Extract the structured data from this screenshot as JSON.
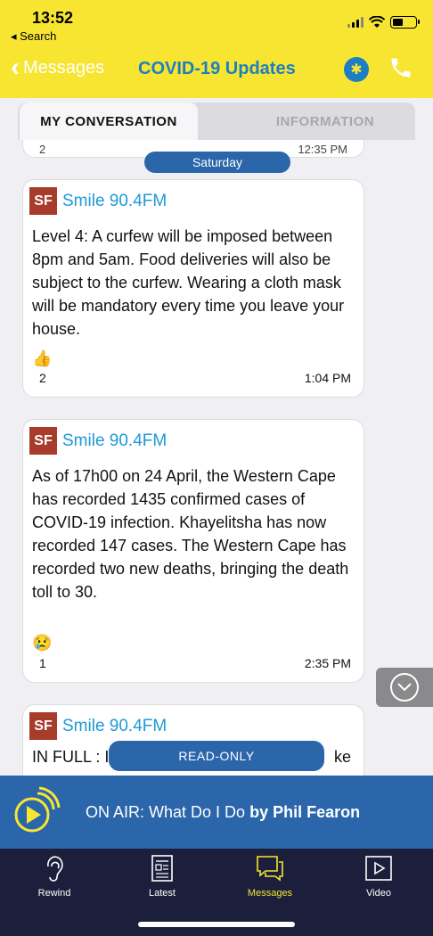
{
  "status_bar": {
    "time": "13:52",
    "back_app": "◂ Search"
  },
  "nav": {
    "back_label": "Messages",
    "title": "COVID-19 Updates"
  },
  "tabs": [
    {
      "label": "MY CONVERSATION",
      "active": true
    },
    {
      "label": "INFORMATION",
      "active": false
    }
  ],
  "feed": {
    "prev_fragment_left": "2",
    "prev_fragment_right": "12:35 PM",
    "date_separator": "Saturday",
    "messages": [
      {
        "avatar": "SF",
        "sender": "Smile 90.4FM",
        "text": "Level 4: A curfew will be imposed between 8pm and 5am. Food deliveries will also be subject to the curfew. Wearing a cloth mask will be mandatory every time you leave your house.",
        "reaction": "👍",
        "reaction_count": "2",
        "time": "1:04 PM"
      },
      {
        "avatar": "SF",
        "sender": "Smile 90.4FM",
        "text": "As of 17h00 on 24 April, the Western Cape has recorded 1435 confirmed cases of COVID-19 infection. Khayelitsha has now recorded 147 cases. The Western Cape has recorded two new deaths, bringing the death toll to 30.",
        "reaction": "😢",
        "reaction_count": "1",
        "time": "2:35 PM"
      },
      {
        "avatar": "SF",
        "sender": "Smile 90.4FM",
        "fragment_left": "IN FULL : I",
        "fragment_right": "ke"
      }
    ],
    "read_only_label": "READ-ONLY"
  },
  "on_air": {
    "prefix": "ON AIR: What Do I Do",
    "by": "by Phil Fearon"
  },
  "bottom_nav": [
    {
      "label": "Rewind",
      "icon": "ear-icon"
    },
    {
      "label": "Latest",
      "icon": "newspaper-icon"
    },
    {
      "label": "Messages",
      "icon": "chat-icon",
      "active": true
    },
    {
      "label": "Video",
      "icon": "play-icon"
    }
  ],
  "colors": {
    "header_yellow": "#f7e532",
    "brand_blue": "#1d7fc1",
    "sender_blue": "#1d9ad6",
    "pill_blue": "#2b66ab",
    "avatar_red": "#a73c2c",
    "nav_dark": "#1b1f3b"
  }
}
